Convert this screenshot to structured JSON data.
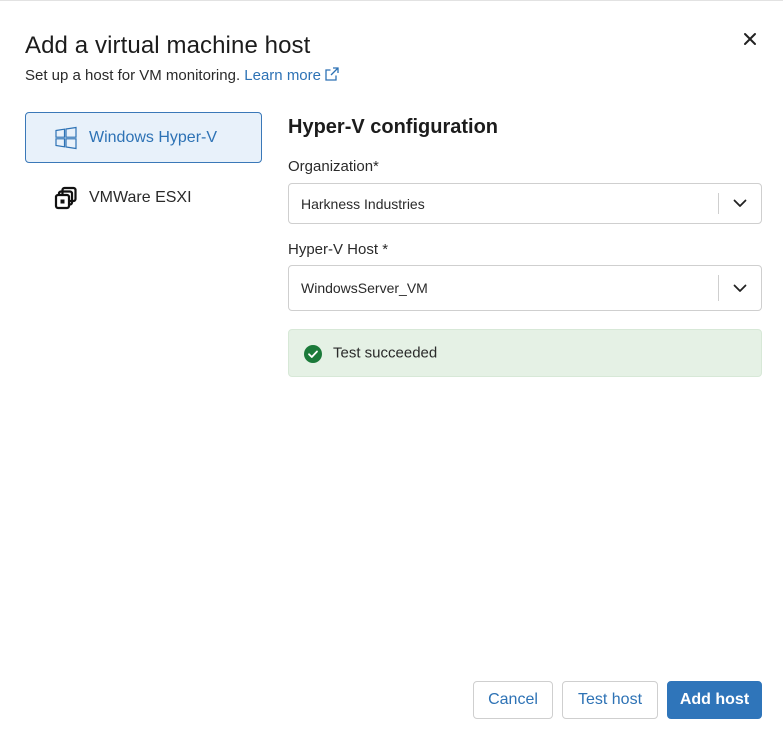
{
  "dialog": {
    "title": "Add a virtual machine host",
    "subtitle": "Set up a host for VM monitoring.",
    "learn_more": "Learn more",
    "close_icon": "close-icon"
  },
  "sidebar": {
    "items": [
      {
        "label": "Windows Hyper-V",
        "icon": "windows-icon",
        "selected": true
      },
      {
        "label": "VMWare ESXI",
        "icon": "vmware-icon",
        "selected": false
      }
    ]
  },
  "config": {
    "title": "Hyper-V configuration",
    "organization": {
      "label": "Organization*",
      "value": "Harkness Industries"
    },
    "host": {
      "label": "Hyper-V Host *",
      "value": "WindowsServer_VM"
    },
    "status": {
      "message": "Test succeeded",
      "icon": "check-circle-icon",
      "color": "#1b7a3a"
    }
  },
  "footer": {
    "cancel": "Cancel",
    "test_host": "Test host",
    "add_host": "Add host"
  },
  "colors": {
    "accent": "#2f75ba",
    "link": "#2d72b5",
    "success_bg": "#e5f1e5",
    "selected_bg": "#e8f1fa"
  }
}
